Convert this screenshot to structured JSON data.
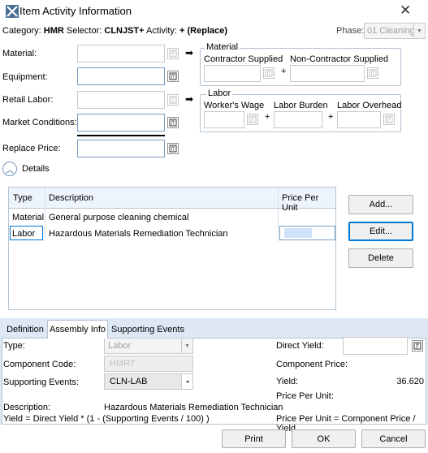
{
  "window": {
    "title": "Item Activity Information",
    "close_glyph": "✕"
  },
  "header": {
    "category_label": "Category:",
    "category_value": "HMR",
    "selector_label": "Selector:",
    "selector_value": "CLNJST+",
    "activity_label": "Activity:",
    "activity_value": "+ (Replace)",
    "phase_label": "Phase:",
    "phase_value": "01 Cleaning"
  },
  "left_fields": {
    "material": "Material:",
    "equipment": "Equipment:",
    "retail_labor": "Retail Labor:",
    "market_conditions": "Market Conditions:",
    "replace_price": "Replace Price:"
  },
  "material_group": {
    "title": "Material",
    "contractor_supplied": "Contractor Supplied",
    "non_contractor_supplied": "Non-Contractor Supplied",
    "plus": "+"
  },
  "labor_group": {
    "title": "Labor",
    "workers_wage": "Worker's Wage",
    "labor_burden": "Labor Burden",
    "labor_overhead": "Labor Overhead",
    "plus": "+"
  },
  "details": {
    "label": "Details",
    "toggle_glyph": "︿"
  },
  "grid": {
    "columns": [
      "Type",
      "Description",
      "Price Per Unit"
    ],
    "rows": [
      {
        "type": "Material",
        "description": "General purpose cleaning chemical",
        "price": ""
      },
      {
        "type": "Labor",
        "description": "Hazardous Materials Remediation Technician",
        "price": ""
      }
    ]
  },
  "actions": {
    "add": "Add...",
    "edit": "Edit...",
    "delete": "Delete"
  },
  "tabs": [
    "Definition",
    "Assembly Info",
    "Supporting Events"
  ],
  "assembly": {
    "type_label": "Type:",
    "type_value": "Labor",
    "component_code_label": "Component Code:",
    "component_code_value": "HMRT",
    "supporting_events_label": "Supporting Events:",
    "supporting_events_value": "CLN-LAB",
    "description_label": "Description:",
    "description_value": "Hazardous Materials Remediation Technician",
    "yield_formula": "Yield = Direct Yield * (1 - (Supporting Events / 100) )",
    "direct_yield_label": "Direct Yield:",
    "component_price_label": "Component Price:",
    "yield_label": "Yield:",
    "yield_value": "36.620",
    "price_per_unit_label": "Price Per Unit:",
    "price_formula": "Price Per Unit = Component Price / Yield"
  },
  "footer": {
    "print": "Print",
    "ok": "OK",
    "cancel": "Cancel"
  },
  "colors": {
    "accent": "#0078d7",
    "group_border": "#b3c4d4",
    "selection": "#cfe2f7"
  }
}
